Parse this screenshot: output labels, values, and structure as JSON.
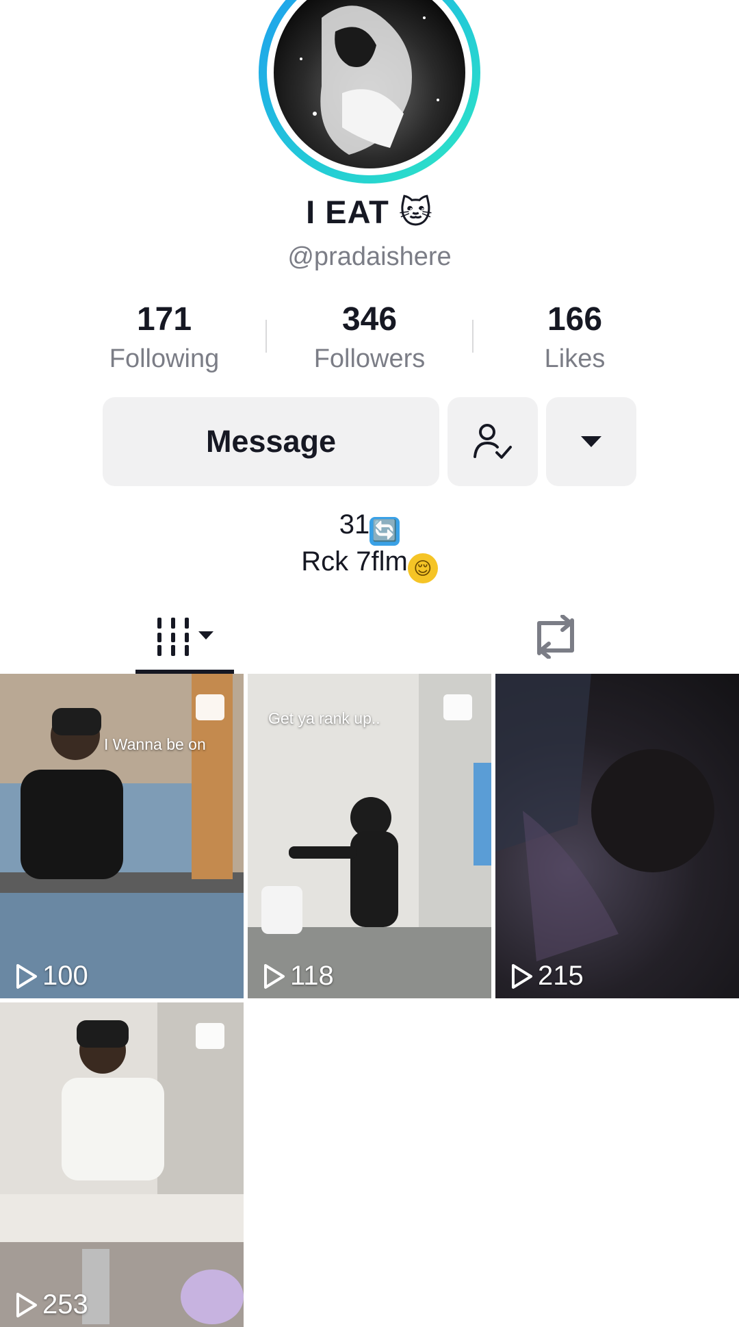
{
  "profile": {
    "display_name": "I EAT 🐱",
    "handle": "@pradaishere",
    "avatar_icon": "profile-photo"
  },
  "stats": [
    {
      "value": "171",
      "label": "Following"
    },
    {
      "value": "346",
      "label": "Followers"
    },
    {
      "value": "166",
      "label": "Likes"
    }
  ],
  "actions": {
    "message_label": "Message",
    "friend_icon": "person-check-icon",
    "more_icon": "caret-down-icon"
  },
  "bio": {
    "line1_text": "31",
    "line1_emoji": "🔄",
    "line2_text": "Rck 7flm",
    "line2_emoji": "😌"
  },
  "tabs": [
    {
      "name": "videos",
      "icon": "grid-icon",
      "active": true
    },
    {
      "name": "reposts",
      "icon": "repost-icon",
      "active": false
    }
  ],
  "videos": [
    {
      "views": "100",
      "caption": "I Wanna be on",
      "photo_badge": true
    },
    {
      "views": "118",
      "caption": "Get ya rank up..",
      "photo_badge": true
    },
    {
      "views": "215",
      "caption": "",
      "photo_badge": false
    },
    {
      "views": "253",
      "caption": "",
      "photo_badge": true
    }
  ],
  "colors": {
    "text": "#161823",
    "muted": "#7b7d86",
    "button_bg": "#f1f1f2",
    "ring_start": "#1e9bf0",
    "ring_end": "#2ee6c4"
  }
}
